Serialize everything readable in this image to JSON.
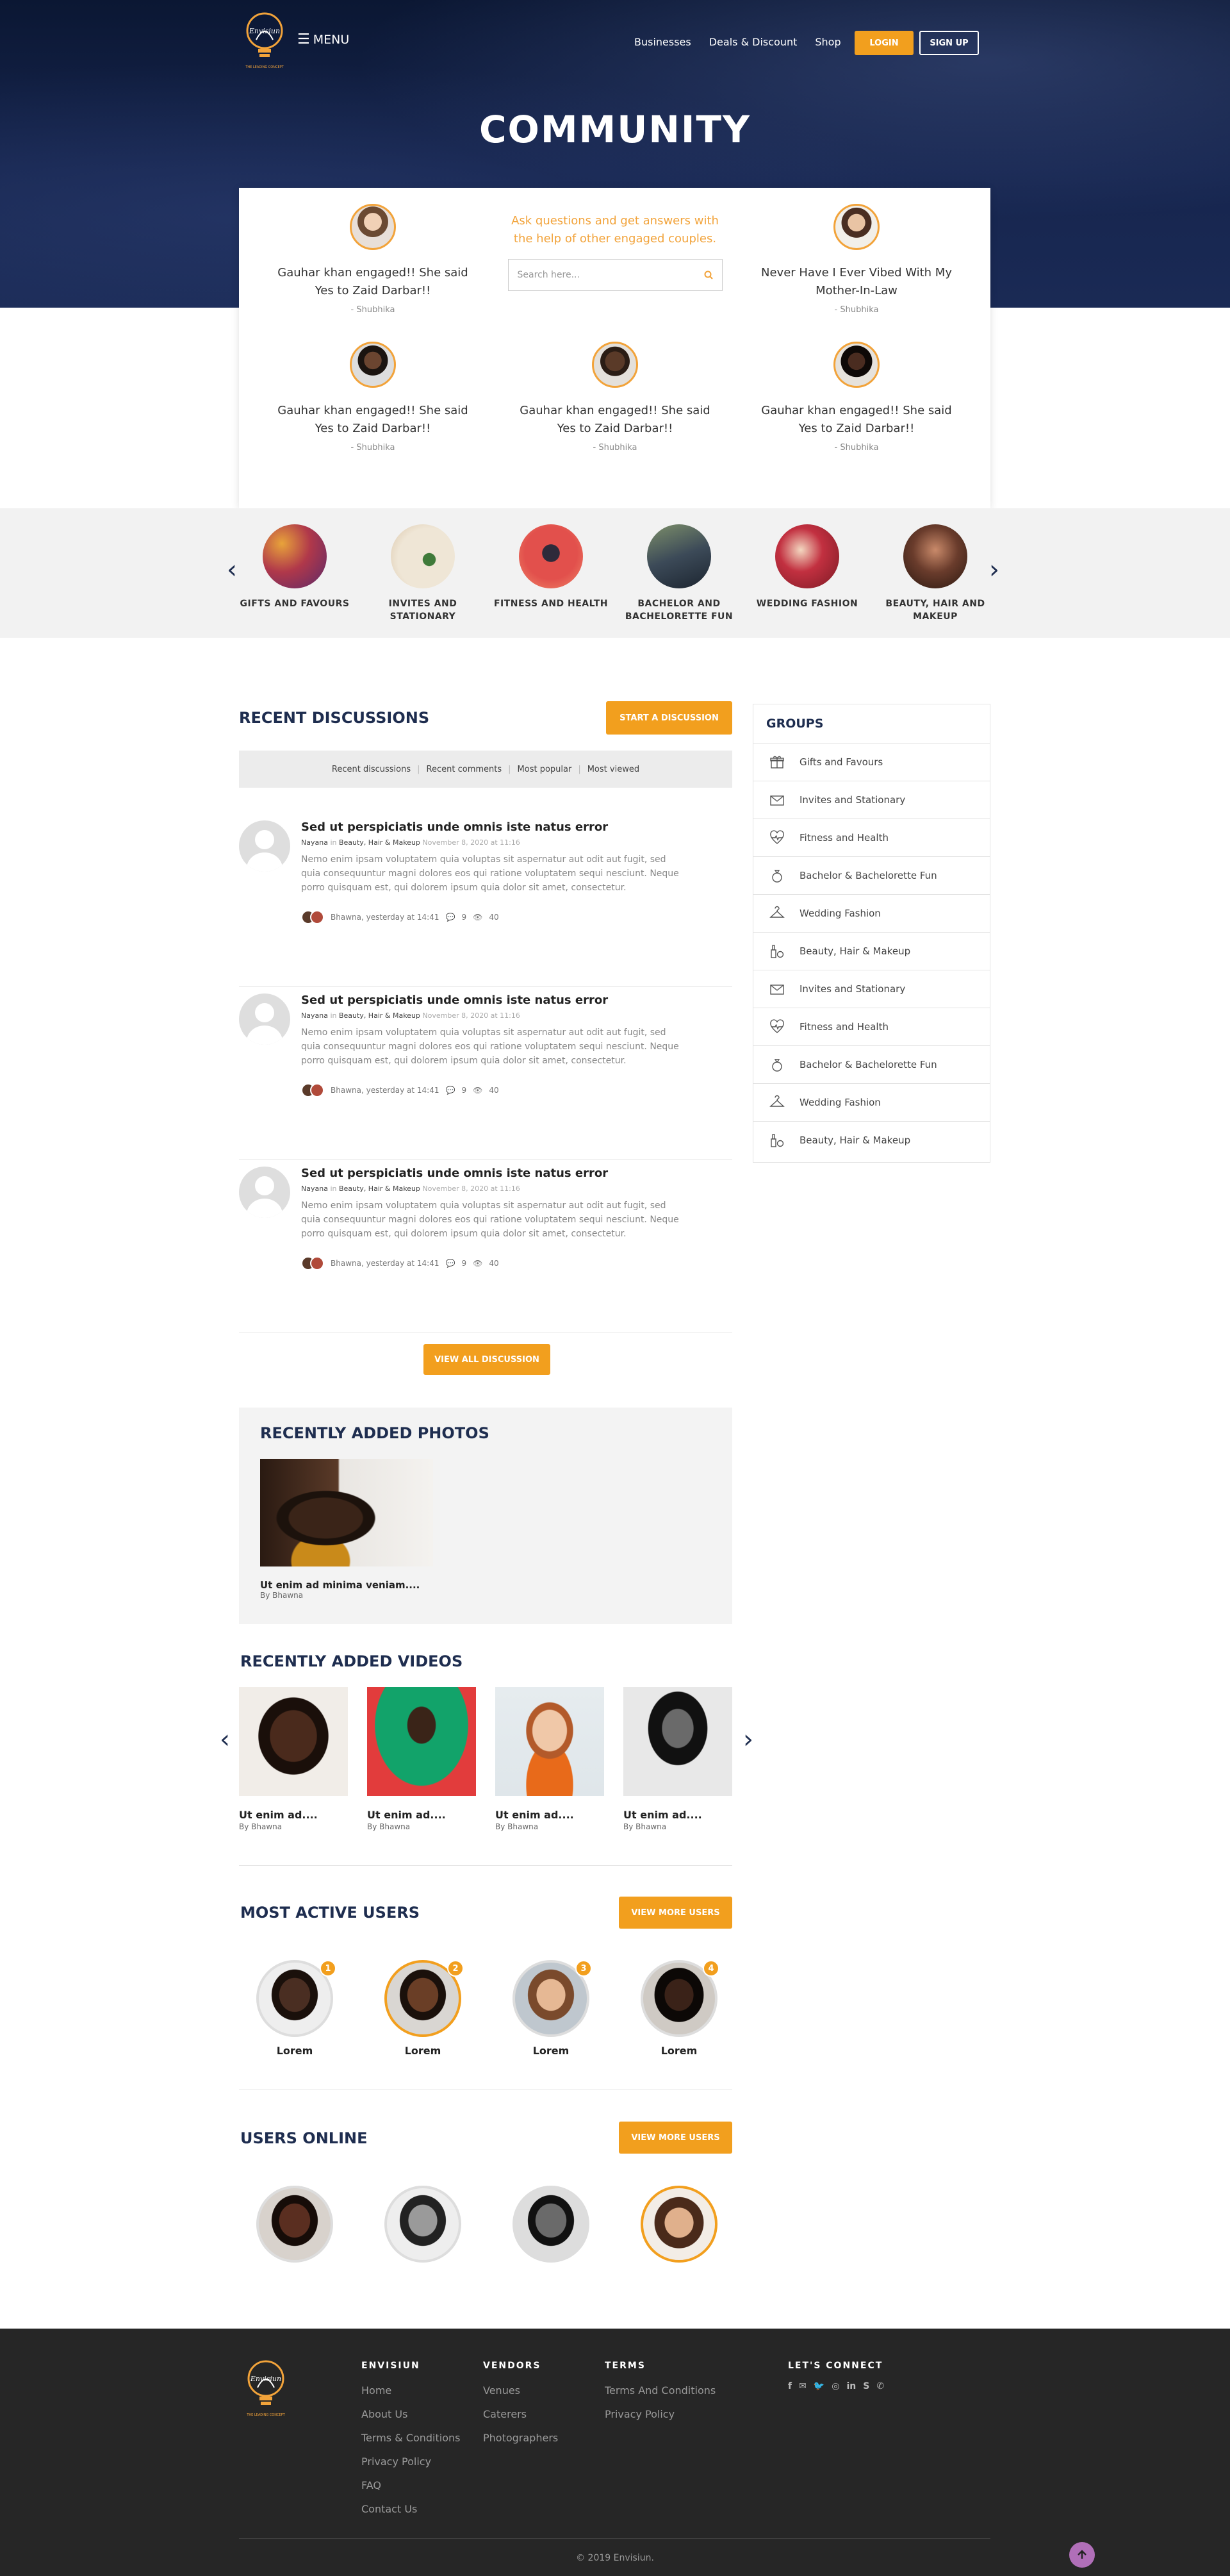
{
  "header": {
    "logo_text": "Envisiun",
    "logo_tagline": "THE LEADING CONCEPT",
    "menu_label": "MENU",
    "nav": [
      "Businesses",
      "Deals & Discount",
      "Shop"
    ],
    "login": "LOGIN",
    "signup": "SIGN UP",
    "page_title": "COMMUNITY"
  },
  "stories": [
    {
      "title": "Gauhar khan engaged!! She said Yes to Zaid Darbar!!",
      "by": "- Shubhika"
    },
    {
      "title": "Never Have I Ever Vibed With My Mother-In-Law",
      "by": "- Shubhika"
    },
    {
      "title": "Gauhar khan engaged!! She said Yes to Zaid Darbar!!",
      "by": "- Shubhika"
    },
    {
      "title": "Gauhar khan engaged!! She said Yes to Zaid Darbar!!",
      "by": "- Shubhika"
    },
    {
      "title": "Gauhar khan engaged!! She said Yes to Zaid Darbar!!",
      "by": "- Shubhika"
    }
  ],
  "ask": {
    "text": "Ask questions and get answers with the help of other engaged couples.",
    "placeholder": "Search here..."
  },
  "categories": [
    {
      "label": "GIFTS AND FAVOURS",
      "color": "#b0384a"
    },
    {
      "label": "INVITES AND STATIONARY",
      "color": "#efe6d6"
    },
    {
      "label": "FITNESS AND HEALTH",
      "color": "#e2504c"
    },
    {
      "label": "BACHELOR AND BACHELORETTE FUN",
      "color": "#3c4a58"
    },
    {
      "label": "WEDDING FASHION",
      "color": "#c23040"
    },
    {
      "label": "BEAUTY, HAIR AND MAKEUP",
      "color": "#6a3c2c"
    }
  ],
  "discussions": {
    "title": "RECENT DISCUSSIONS",
    "start_button": "START A DISCUSSION",
    "tabs": [
      "Recent discussions",
      "Recent comments",
      "Most popular",
      "Most viewed"
    ],
    "items": [
      {
        "title": "Sed ut perspiciatis unde omnis iste natus error",
        "author": "Nayana",
        "in": "in",
        "category": "Beauty, Hair & Makeup",
        "date": "November 8, 2020 at 11:16",
        "body": "Nemo enim ipsam voluptatem quia voluptas sit aspernatur aut odit aut fugit, sed quia consequuntur magni dolores eos qui ratione voluptatem sequi nesciunt. Neque porro quisquam est, qui dolorem ipsum quia dolor sit amet, consectetur.",
        "last": "Bhawna, yesterday at 14:41",
        "comments": "9",
        "views": "40"
      },
      {
        "title": "Sed ut perspiciatis unde omnis iste natus error",
        "author": "Nayana",
        "in": "in",
        "category": "Beauty, Hair & Makeup",
        "date": "November 8, 2020 at 11:16",
        "body": "Nemo enim ipsam voluptatem quia voluptas sit aspernatur aut odit aut fugit, sed quia consequuntur magni dolores eos qui ratione voluptatem sequi nesciunt. Neque porro quisquam est, qui dolorem ipsum quia dolor sit amet, consectetur.",
        "last": "Bhawna, yesterday at 14:41",
        "comments": "9",
        "views": "40"
      },
      {
        "title": "Sed ut perspiciatis unde omnis iste natus error",
        "author": "Nayana",
        "in": "in",
        "category": "Beauty, Hair & Makeup",
        "date": "November 8, 2020 at 11:16",
        "body": "Nemo enim ipsam voluptatem quia voluptas sit aspernatur aut odit aut fugit, sed quia consequuntur magni dolores eos qui ratione voluptatem sequi nesciunt. Neque porro quisquam est, qui dolorem ipsum quia dolor sit amet, consectetur.",
        "last": "Bhawna, yesterday at 14:41",
        "comments": "9",
        "views": "40"
      }
    ],
    "view_all": "VIEW ALL DISCUSSION"
  },
  "groups": {
    "title": "GROUPS",
    "items": [
      {
        "label": "Gifts and Favours",
        "icon": "gift-icon"
      },
      {
        "label": "Invites and Stationary",
        "icon": "envelope-icon"
      },
      {
        "label": "Fitness and Health",
        "icon": "heartbeat-icon"
      },
      {
        "label": "Bachelor & Bachelorette Fun",
        "icon": "ring-icon"
      },
      {
        "label": "Wedding Fashion",
        "icon": "hanger-icon"
      },
      {
        "label": "Beauty, Hair & Makeup",
        "icon": "makeup-icon"
      },
      {
        "label": "Invites and Stationary",
        "icon": "envelope-icon"
      },
      {
        "label": "Fitness and Health",
        "icon": "heartbeat-icon"
      },
      {
        "label": "Bachelor & Bachelorette Fun",
        "icon": "ring-icon"
      },
      {
        "label": "Wedding Fashion",
        "icon": "hanger-icon"
      },
      {
        "label": "Beauty, Hair & Makeup",
        "icon": "makeup-icon"
      }
    ]
  },
  "photos": {
    "title": "RECENTLY ADDED PHOTOS",
    "item": {
      "title": "Ut enim ad minima veniam....",
      "by": "By Bhawna"
    }
  },
  "videos": {
    "title": "RECENTLY ADDED VIDEOS",
    "items": [
      {
        "title": "Ut enim ad....",
        "by": "By Bhawna"
      },
      {
        "title": "Ut enim ad....",
        "by": "By Bhawna"
      },
      {
        "title": "Ut enim ad....",
        "by": "By Bhawna"
      },
      {
        "title": "Ut enim ad....",
        "by": "By Bhawna"
      }
    ]
  },
  "active_users": {
    "title": "MOST ACTIVE USERS",
    "button": "VIEW MORE USERS",
    "users": [
      {
        "name": "Lorem",
        "rank": "1"
      },
      {
        "name": "Lorem",
        "rank": "2"
      },
      {
        "name": "Lorem",
        "rank": "3"
      },
      {
        "name": "Lorem",
        "rank": "4"
      }
    ]
  },
  "online_users": {
    "title": "USERS ONLINE",
    "button": "VIEW MORE USERS"
  },
  "footer": {
    "logo_text": "Envisiun",
    "logo_tagline": "THE LEADING CONCEPT",
    "col1": {
      "title": "ENVISIUN",
      "links": [
        "Home",
        "About Us",
        "Terms & Conditions",
        "Privacy Policy",
        "FAQ",
        "Contact Us"
      ]
    },
    "col2": {
      "title": "VENDORS",
      "links": [
        "Venues",
        "Caterers",
        "Photographers"
      ]
    },
    "col3": {
      "title": "TERMS",
      "links": [
        "Terms And Conditions",
        "Privacy Policy"
      ]
    },
    "connect_title": "LET'S CONNECT",
    "social": [
      "facebook-icon",
      "email-icon",
      "twitter-icon",
      "instagram-icon",
      "linkedin-icon",
      "skype-icon",
      "whatsapp-icon"
    ],
    "copyright": "© 2019 Envisiun."
  }
}
